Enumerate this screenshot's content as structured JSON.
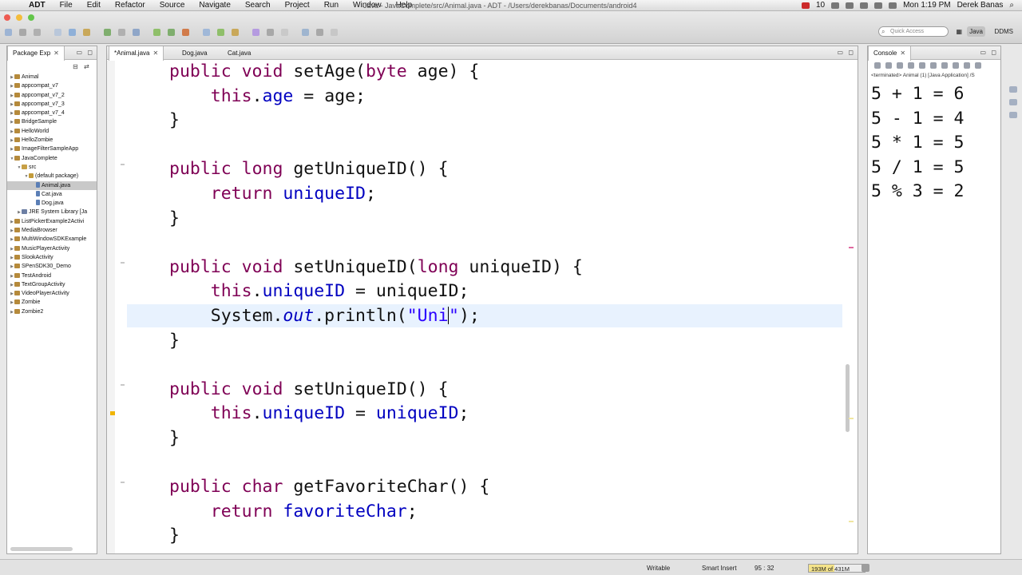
{
  "menubar": {
    "app": "ADT",
    "items": [
      "File",
      "Edit",
      "Refactor",
      "Source",
      "Navigate",
      "Search",
      "Project",
      "Run",
      "Window",
      "Help"
    ],
    "window_title": "Java - JavaComplete/src/Animal.java - ADT - /Users/derekbanas/Documents/android4",
    "status_count": "10",
    "clock": "Mon 1:19 PM",
    "user": "Derek Banas"
  },
  "toolbar": {
    "quick_access_placeholder": "Quick Access",
    "perspectives": [
      "Java",
      "DDMS"
    ]
  },
  "package_explorer": {
    "title": "Package Exp",
    "tree": [
      {
        "label": "Animal",
        "level": 0,
        "kind": "proj",
        "expanded": false
      },
      {
        "label": "appcompat_v7",
        "level": 0,
        "kind": "proj",
        "expanded": false
      },
      {
        "label": "appcompat_v7_2",
        "level": 0,
        "kind": "proj",
        "expanded": false
      },
      {
        "label": "appcompat_v7_3",
        "level": 0,
        "kind": "proj",
        "expanded": false
      },
      {
        "label": "appcompat_v7_4",
        "level": 0,
        "kind": "proj",
        "expanded": false
      },
      {
        "label": "BridgeSample",
        "level": 0,
        "kind": "proj",
        "expanded": false
      },
      {
        "label": "HelloWorld",
        "level": 0,
        "kind": "proj",
        "expanded": false
      },
      {
        "label": "HelloZombie",
        "level": 0,
        "kind": "proj",
        "expanded": false
      },
      {
        "label": "ImageFilterSampleApp",
        "level": 0,
        "kind": "proj",
        "expanded": false
      },
      {
        "label": "JavaComplete",
        "level": 0,
        "kind": "proj",
        "expanded": true
      },
      {
        "label": "src",
        "level": 1,
        "kind": "src",
        "expanded": true
      },
      {
        "label": "(default package)",
        "level": 2,
        "kind": "pkg",
        "expanded": true
      },
      {
        "label": "Animal.java",
        "level": 3,
        "kind": "java",
        "expanded": false,
        "selected": true
      },
      {
        "label": "Cat.java",
        "level": 3,
        "kind": "java",
        "expanded": false
      },
      {
        "label": "Dog.java",
        "level": 3,
        "kind": "java",
        "expanded": false
      },
      {
        "label": "JRE System Library [Ja",
        "level": 1,
        "kind": "lib",
        "expanded": false
      },
      {
        "label": "ListPickerExample2Activi",
        "level": 0,
        "kind": "proj",
        "expanded": false
      },
      {
        "label": "MediaBrowser",
        "level": 0,
        "kind": "proj",
        "expanded": false
      },
      {
        "label": "MultiWindowSDKExample",
        "level": 0,
        "kind": "proj",
        "expanded": false
      },
      {
        "label": "MusicPlayerActivity",
        "level": 0,
        "kind": "proj",
        "expanded": false
      },
      {
        "label": "SlookActivity",
        "level": 0,
        "kind": "proj",
        "expanded": false
      },
      {
        "label": "SPenSDK30_Demo",
        "level": 0,
        "kind": "proj",
        "expanded": false
      },
      {
        "label": "TestAndroid",
        "level": 0,
        "kind": "proj",
        "expanded": false
      },
      {
        "label": "TextGroupActivity",
        "level": 0,
        "kind": "proj",
        "expanded": false
      },
      {
        "label": "VideoPlayerActivity",
        "level": 0,
        "kind": "proj",
        "expanded": false
      },
      {
        "label": "Zombie",
        "level": 0,
        "kind": "proj",
        "expanded": false
      },
      {
        "label": "Zombie2",
        "level": 0,
        "kind": "proj",
        "expanded": false
      }
    ]
  },
  "editor": {
    "tabs": [
      "*Animal.java",
      "Dog.java",
      "Cat.java"
    ],
    "lines": [
      [
        {
          "t": "public void ",
          "c": "kw-split"
        },
        {
          "t": "setAge(",
          "c": ""
        },
        {
          "t": "byte",
          "c": "kw"
        },
        {
          "t": " age) {",
          "c": ""
        }
      ],
      [
        {
          "t": "    ",
          "c": ""
        },
        {
          "t": "this",
          "c": "kw"
        },
        {
          "t": ".",
          "c": ""
        },
        {
          "t": "age",
          "c": "fld"
        },
        {
          "t": " = age;",
          "c": ""
        }
      ],
      [
        {
          "t": "}",
          "c": ""
        }
      ],
      [
        {
          "t": "",
          "c": ""
        }
      ],
      [
        {
          "t": "public",
          "c": "kw"
        },
        {
          "t": " ",
          "c": ""
        },
        {
          "t": "long",
          "c": "kw"
        },
        {
          "t": " getUniqueID() {",
          "c": ""
        }
      ],
      [
        {
          "t": "    ",
          "c": ""
        },
        {
          "t": "return",
          "c": "kw"
        },
        {
          "t": " ",
          "c": ""
        },
        {
          "t": "uniqueID",
          "c": "fld"
        },
        {
          "t": ";",
          "c": ""
        }
      ],
      [
        {
          "t": "}",
          "c": ""
        }
      ],
      [
        {
          "t": "",
          "c": ""
        }
      ],
      [
        {
          "t": "public",
          "c": "kw"
        },
        {
          "t": " ",
          "c": ""
        },
        {
          "t": "void",
          "c": "kw"
        },
        {
          "t": " setUniqueID(",
          "c": ""
        },
        {
          "t": "long",
          "c": "kw"
        },
        {
          "t": " uniqueID) {",
          "c": ""
        }
      ],
      [
        {
          "t": "    ",
          "c": ""
        },
        {
          "t": "this",
          "c": "kw"
        },
        {
          "t": ".",
          "c": ""
        },
        {
          "t": "uniqueID",
          "c": "fld"
        },
        {
          "t": " = uniqueID;",
          "c": ""
        }
      ],
      [
        {
          "t": "    System.",
          "c": ""
        },
        {
          "t": "out",
          "c": "sfld"
        },
        {
          "t": ".println(",
          "c": ""
        },
        {
          "t": "\"Uni",
          "c": "str"
        },
        {
          "t": "CARET",
          "c": "caret"
        },
        {
          "t": "\"",
          "c": "str"
        },
        {
          "t": ");",
          "c": ""
        }
      ],
      [
        {
          "t": "}",
          "c": ""
        }
      ],
      [
        {
          "t": "",
          "c": ""
        }
      ],
      [
        {
          "t": "public",
          "c": "kw"
        },
        {
          "t": " ",
          "c": ""
        },
        {
          "t": "void",
          "c": "kw"
        },
        {
          "t": " setUniqueID() {",
          "c": ""
        }
      ],
      [
        {
          "t": "    ",
          "c": ""
        },
        {
          "t": "this",
          "c": "kw"
        },
        {
          "t": ".",
          "c": ""
        },
        {
          "t": "uniqueID",
          "c": "fld"
        },
        {
          "t": " = ",
          "c": ""
        },
        {
          "t": "uniqueID",
          "c": "fld"
        },
        {
          "t": ";",
          "c": ""
        }
      ],
      [
        {
          "t": "}",
          "c": ""
        }
      ],
      [
        {
          "t": "",
          "c": ""
        }
      ],
      [
        {
          "t": "public",
          "c": "kw"
        },
        {
          "t": " ",
          "c": ""
        },
        {
          "t": "char",
          "c": "kw"
        },
        {
          "t": " getFavoriteChar() {",
          "c": ""
        }
      ],
      [
        {
          "t": "    ",
          "c": ""
        },
        {
          "t": "return",
          "c": "kw"
        },
        {
          "t": " ",
          "c": ""
        },
        {
          "t": "favoriteChar",
          "c": "fld"
        },
        {
          "t": ";",
          "c": ""
        }
      ],
      [
        {
          "t": "}",
          "c": ""
        }
      ]
    ],
    "current_line_index": 10
  },
  "console": {
    "title": "Console",
    "description": "<terminated> Animal (1) [Java Application] /S",
    "output": [
      "5 + 1 = 6",
      "5 - 1 = 4",
      "5 * 1 = 5",
      "5 / 1 = 5",
      "5 % 3 = 2"
    ]
  },
  "statusbar": {
    "writable": "Writable",
    "insert_mode": "Smart Insert",
    "position": "95 : 32",
    "heap": "193M of 431M",
    "heap_fraction": 0.45
  },
  "colors": {
    "keyword": "#7f0055",
    "field": "#0000c0",
    "string": "#2a00ff",
    "current_line": "#e8f2fe"
  }
}
